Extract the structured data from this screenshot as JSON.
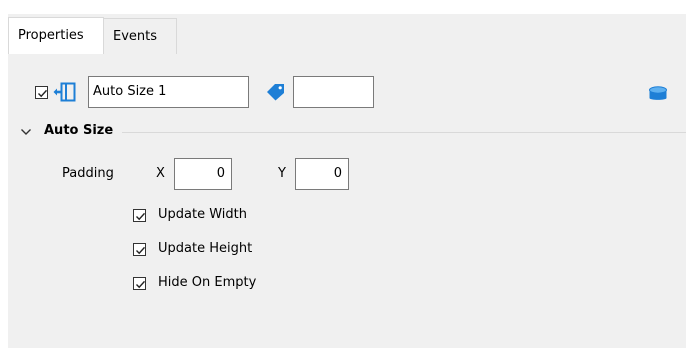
{
  "tabs": {
    "properties": "Properties",
    "events": "Events"
  },
  "header": {
    "name_value": "Auto Size 1",
    "tag_value": ""
  },
  "section": {
    "title": "Auto Size"
  },
  "padding": {
    "label": "Padding",
    "x_label": "X",
    "x_value": "0",
    "y_label": "Y",
    "y_value": "0"
  },
  "options": {
    "update_width": "Update Width",
    "update_height": "Update Height",
    "hide_on_empty": "Hide On Empty"
  },
  "colors": {
    "accent": "#1e7fd6",
    "panel_bg": "#f0f0f0",
    "divider": "#d9d9d9"
  },
  "icons": {
    "component": "component-icon",
    "tag": "tag-icon",
    "database": "database-icon",
    "chevron": "chevron-down-icon"
  }
}
